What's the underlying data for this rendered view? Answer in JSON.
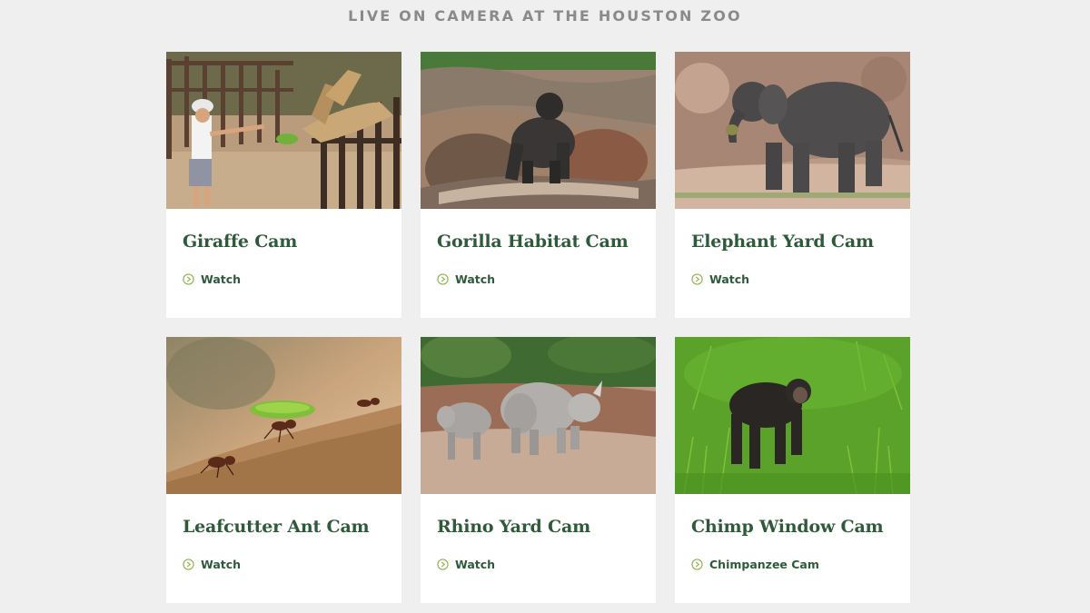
{
  "section": {
    "title": "LIVE ON CAMERA AT THE HOUSTON ZOO"
  },
  "colors": {
    "background": "#efefef",
    "card": "#ffffff",
    "title_green": "#2f5a3a",
    "heading_gray": "#8a8a8a",
    "icon_green": "#8fb24a"
  },
  "cams": [
    {
      "title": "Giraffe Cam",
      "link_label": "Watch",
      "image": "giraffe-photo",
      "link_icon": "play-circle-icon"
    },
    {
      "title": "Gorilla Habitat Cam",
      "link_label": "Watch",
      "image": "gorilla-photo",
      "link_icon": "play-circle-icon"
    },
    {
      "title": "Elephant Yard Cam",
      "link_label": "Watch",
      "image": "elephant-photo",
      "link_icon": "play-circle-icon"
    },
    {
      "title": "Leafcutter Ant Cam",
      "link_label": "Watch",
      "image": "leafcutter-ant-photo",
      "link_icon": "play-circle-icon"
    },
    {
      "title": "Rhino Yard Cam",
      "link_label": "Watch",
      "image": "rhino-photo",
      "link_icon": "play-circle-icon"
    },
    {
      "title": "Chimp Window Cam",
      "link_label": "Chimpanzee Cam",
      "image": "chimp-photo",
      "link_icon": "play-circle-icon"
    }
  ]
}
